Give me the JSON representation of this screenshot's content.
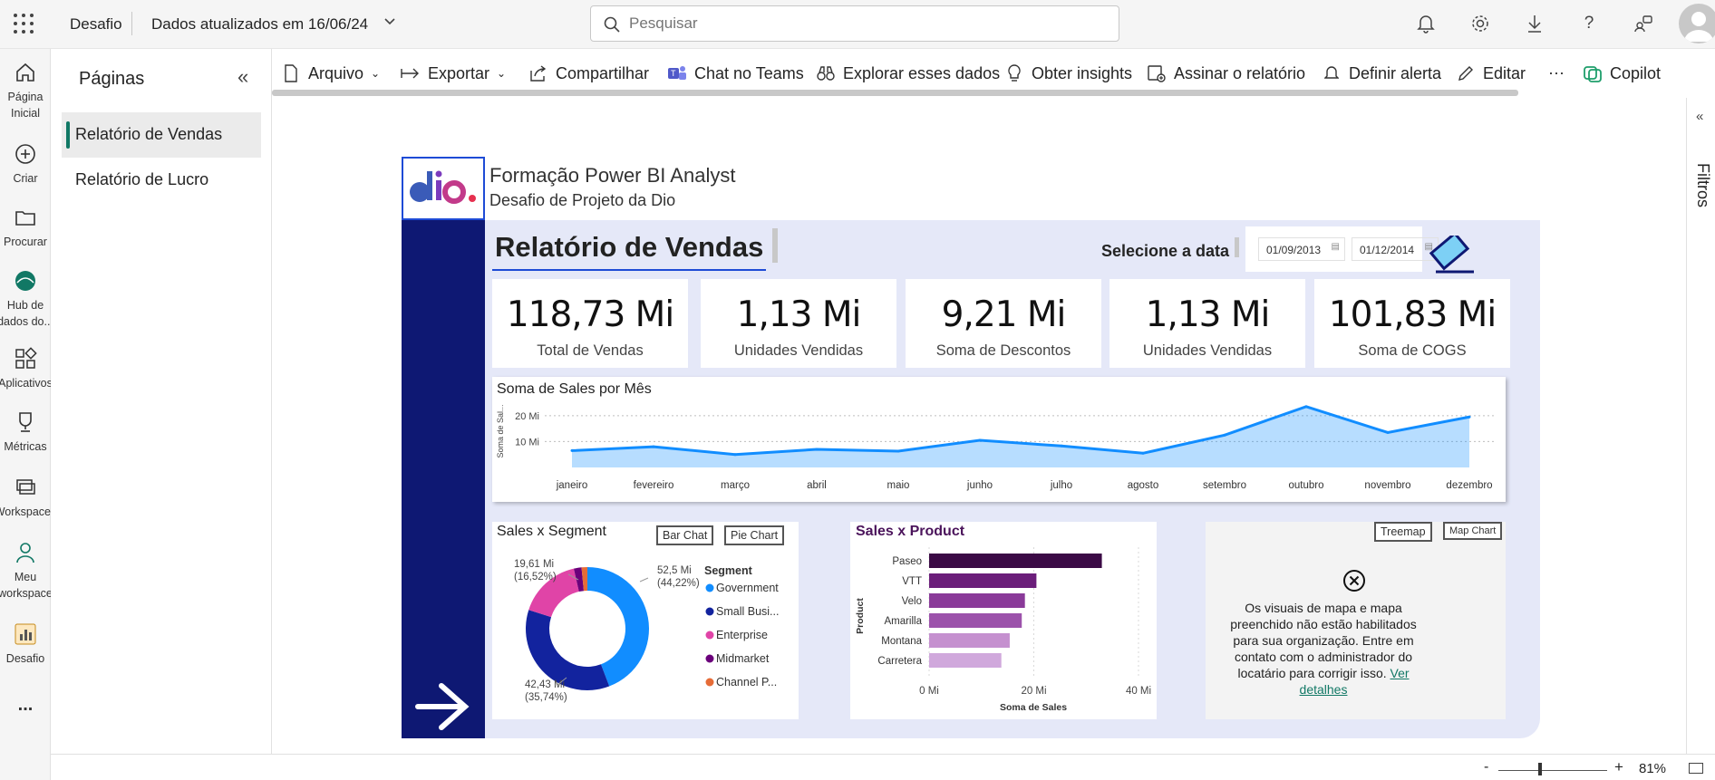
{
  "topbar": {
    "app_name": "Desafio",
    "data_updated": "Dados atualizados em 16/06/24",
    "search_placeholder": "Pesquisar"
  },
  "leftnav": {
    "items": [
      {
        "label": "Página Inicial",
        "icon": "home-icon"
      },
      {
        "label": "Criar",
        "icon": "plus-circle-icon"
      },
      {
        "label": "Procurar",
        "icon": "folder-icon"
      },
      {
        "label": "Hub de dados do...",
        "icon": "data-hub-icon"
      },
      {
        "label": "Aplicativos",
        "icon": "apps-icon"
      },
      {
        "label": "Métricas",
        "icon": "trophy-icon"
      },
      {
        "label": "Workspaces",
        "icon": "workspaces-icon"
      },
      {
        "label": "Meu workspace",
        "icon": "person-icon"
      },
      {
        "label": "Desafio",
        "icon": "report-icon"
      }
    ],
    "more": "..."
  },
  "pages": {
    "title": "Páginas",
    "items": [
      {
        "label": "Relatório de Vendas",
        "active": true
      },
      {
        "label": "Relatório de Lucro",
        "active": false
      }
    ]
  },
  "toolbar": {
    "arquivo": "Arquivo",
    "exportar": "Exportar",
    "compartilhar": "Compartilhar",
    "chat_teams": "Chat no Teams",
    "explorar": "Explorar esses dados",
    "insights": "Obter insights",
    "assinar": "Assinar o relatório",
    "alerta": "Definir alerta",
    "editar": "Editar",
    "more": "···",
    "copilot": "Copilot"
  },
  "filters_label": "Filtros",
  "report": {
    "logo_text": "dio.",
    "brand_line1": "Formação Power BI Analyst",
    "brand_line2": "Desafio de Projeto da Dio",
    "title": "Relatório de Vendas",
    "select_date_label": "Selecione a data",
    "date_from": "01/09/2013",
    "date_to": "01/12/2014",
    "kpis": [
      {
        "value": "118,73 Mi",
        "label": "Total de Vendas"
      },
      {
        "value": "1,13 Mi",
        "label": "Unidades Vendidas"
      },
      {
        "value": "9,21 Mi",
        "label": "Soma de Descontos"
      },
      {
        "value": "1,13 Mi",
        "label": "Unidades Vendidas"
      },
      {
        "value": "101,83 Mi",
        "label": "Soma de COGS"
      }
    ],
    "segment": {
      "title": "Sales x Segment",
      "btn_bar": "Bar Chat",
      "btn_pie": "Pie Chart",
      "legend_title": "Segment",
      "label_gov": "52,5 Mi",
      "label_gov_pct": "(44,22%)",
      "label_small": "42,43 Mi",
      "label_small_pct": "(35,74%)",
      "label_ent": "19,61 Mi",
      "label_ent_pct": "(16,52%)"
    },
    "product": {
      "title": "Sales x Product"
    },
    "map": {
      "btn_treemap": "Treemap",
      "btn_map": "Map Chart",
      "message": "Os visuais de mapa e mapa preenchido não estão habilitados para sua organização. Entre em contato com o administrador do locatário para corrigir isso.",
      "link": "Ver detalhes"
    }
  },
  "zoom": {
    "minus": "-",
    "plus": "+",
    "value": "81%"
  },
  "chart_data": [
    {
      "type": "area",
      "title": "Soma de Sales por Mês",
      "ylabel": "Soma de Sal...",
      "xlabel": "",
      "categories": [
        "janeiro",
        "fevereiro",
        "março",
        "abril",
        "maio",
        "junho",
        "julho",
        "agosto",
        "setembro",
        "outubro",
        "novembro",
        "dezembro"
      ],
      "values": [
        6.5,
        8.0,
        5.0,
        7.0,
        6.3,
        10.5,
        8.3,
        5.5,
        12.5,
        23.5,
        13.5,
        19.5
      ],
      "yticks": [
        "10 Mi",
        "20 Mi"
      ],
      "ylim": [
        0,
        28
      ],
      "color": "#118dff"
    },
    {
      "type": "pie",
      "title": "Sales x Segment",
      "series": [
        {
          "name": "Government",
          "value": 52.5,
          "color": "#118dff"
        },
        {
          "name": "Small Busi...",
          "value": 42.43,
          "color": "#12239e"
        },
        {
          "name": "Enterprise",
          "value": 19.61,
          "color": "#e044a7"
        },
        {
          "name": "Midmarket",
          "value": 2.4,
          "color": "#6b007b"
        },
        {
          "name": "Channel P...",
          "value": 1.8,
          "color": "#e66c37"
        }
      ]
    },
    {
      "type": "bar",
      "title": "Sales x Product",
      "ylabel": "Product",
      "xlabel": "Soma de Sales",
      "categories": [
        "Paseo",
        "VTT",
        "Velo",
        "Amarilla",
        "Montana",
        "Carretera"
      ],
      "values": [
        33.0,
        20.5,
        18.3,
        17.7,
        15.4,
        13.8
      ],
      "colors": [
        "#3b0a45",
        "#6b1e7a",
        "#8a3a99",
        "#9c52ab",
        "#c590cf",
        "#d0a8dc"
      ],
      "xticks": [
        "0 Mi",
        "20 Mi",
        "40 Mi"
      ],
      "xlim": [
        0,
        40
      ]
    }
  ]
}
